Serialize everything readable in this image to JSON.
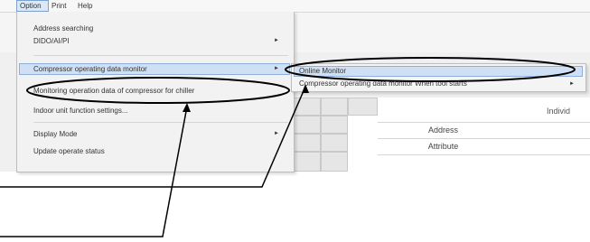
{
  "menubar": {
    "items": [
      "Option",
      "Print",
      "Help"
    ]
  },
  "option_menu": {
    "items": [
      {
        "label": "Address searching",
        "arrow": false
      },
      {
        "label": "DIDO/AI/PI",
        "arrow": true
      },
      {
        "label": "Compressor operating data monitor",
        "arrow": true
      },
      {
        "label": "Monitoring operation data of compressor for chiller",
        "arrow": false
      },
      {
        "label": "Indoor unit function settings...",
        "arrow": false
      },
      {
        "label": "Display Mode",
        "arrow": true
      },
      {
        "label": "Update operate status",
        "arrow": false
      }
    ]
  },
  "submenu": {
    "items": [
      {
        "label": "Online Monitor",
        "arrow": false
      },
      {
        "label": "Compressor operating data monitor When tool starts",
        "arrow": true
      }
    ]
  },
  "grid": {
    "header": "Individ",
    "rows": [
      "Address",
      "Attribute"
    ]
  },
  "colors": {
    "highlight": "#cfe0f5",
    "highlight_border": "#8fb0dc",
    "annotation": "#000000"
  }
}
